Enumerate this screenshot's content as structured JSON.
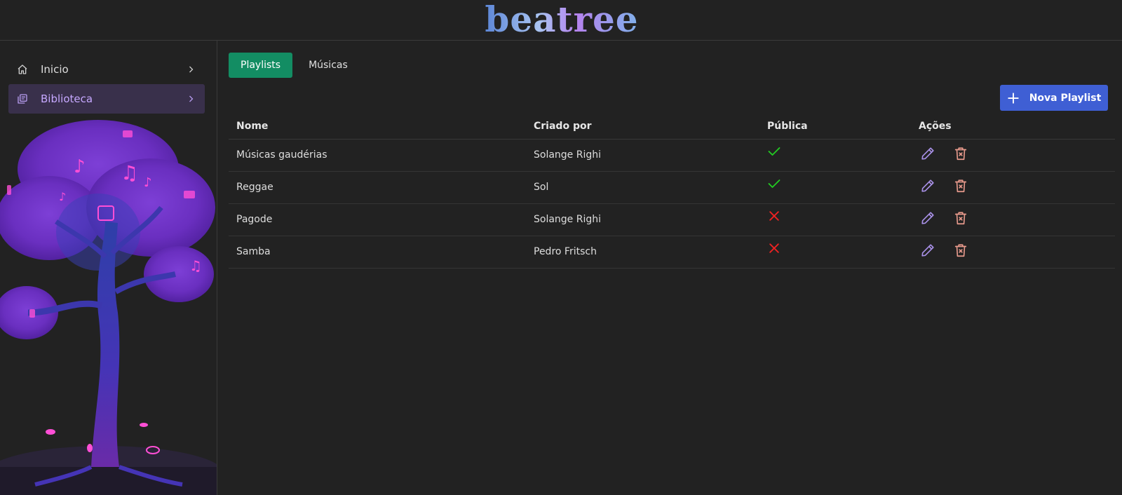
{
  "app": {
    "logo_text": "beatree"
  },
  "sidebar": {
    "items": [
      {
        "label": "Inicio",
        "icon": "home-icon",
        "active": false
      },
      {
        "label": "Biblioteca",
        "icon": "library-icon",
        "active": true
      }
    ]
  },
  "tabs": [
    {
      "label": "Playlists",
      "active": true
    },
    {
      "label": "Músicas",
      "active": false
    }
  ],
  "new_button": {
    "label": "Nova Playlist",
    "icon": "plus-icon"
  },
  "table": {
    "headers": {
      "nome": "Nome",
      "criado_por": "Criado por",
      "publica": "Pública",
      "acoes": "Ações"
    },
    "rows": [
      {
        "nome": "Músicas gaudérias",
        "criado_por": "Solange Righi",
        "publica": true
      },
      {
        "nome": "Reggae",
        "criado_por": "Sol",
        "publica": true
      },
      {
        "nome": "Pagode",
        "criado_por": "Solange Righi",
        "publica": false
      },
      {
        "nome": "Samba",
        "criado_por": "Pedro Fritsch",
        "publica": false
      }
    ]
  },
  "colors": {
    "background": "#222222",
    "active_tab": "#138d63",
    "primary_button": "#3f5fd4",
    "active_nav_text": "#c6a8ff",
    "check": "#22cc22",
    "cross": "#ee2222",
    "edit_icon": "#a991e8",
    "delete_icon": "#e89a8c"
  }
}
